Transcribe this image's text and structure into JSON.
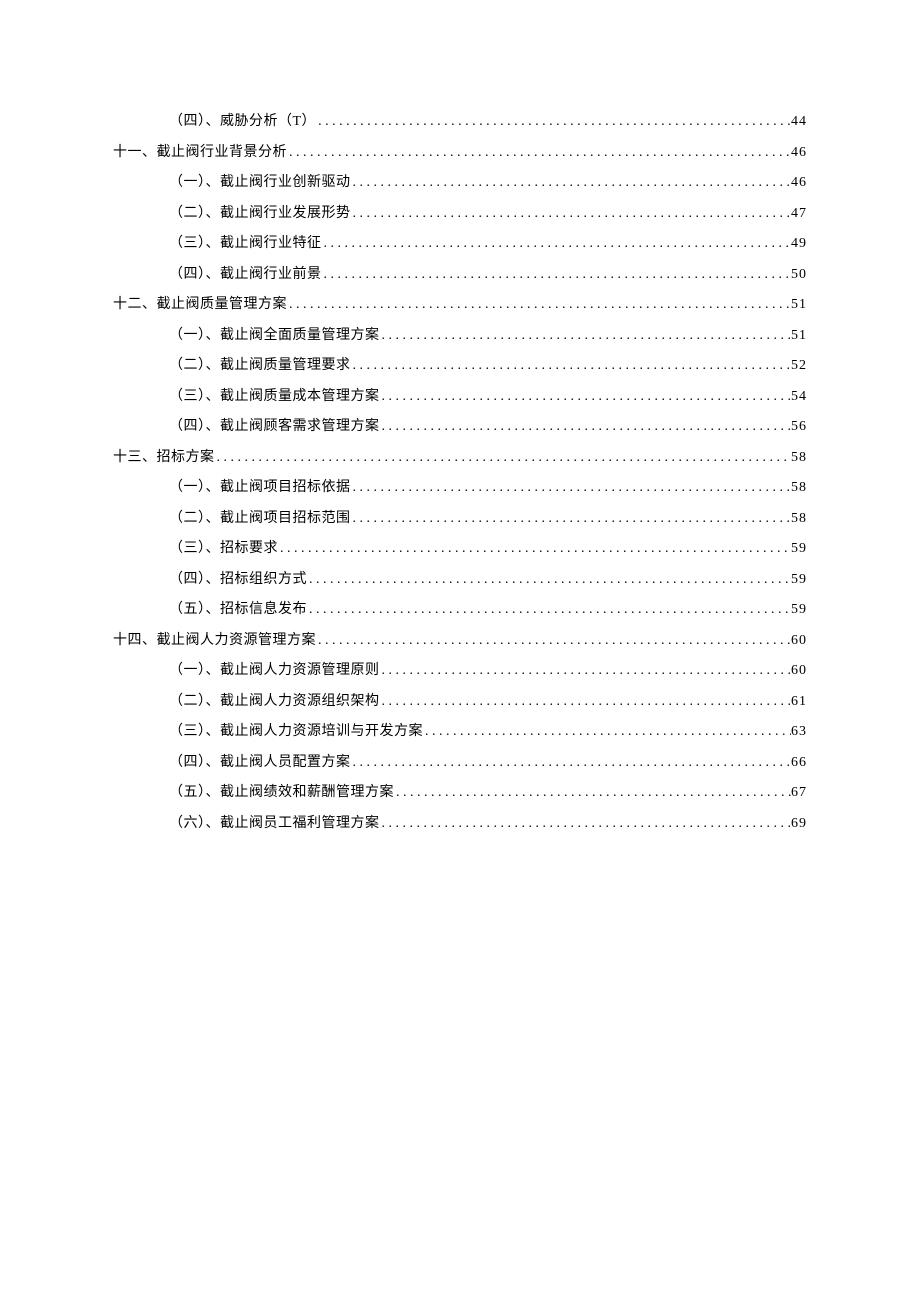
{
  "toc": {
    "entries": [
      {
        "level": 2,
        "title": "（四）、威胁分析（T）",
        "page": "44"
      },
      {
        "level": 1,
        "title": "十一、截止阀行业背景分析",
        "page": "46"
      },
      {
        "level": 2,
        "title": "（一）、截止阀行业创新驱动",
        "page": "46"
      },
      {
        "level": 2,
        "title": "（二）、截止阀行业发展形势",
        "page": "47"
      },
      {
        "level": 2,
        "title": "（三）、截止阀行业特征",
        "page": "49"
      },
      {
        "level": 2,
        "title": "（四）、截止阀行业前景",
        "page": "50"
      },
      {
        "level": 1,
        "title": "十二、截止阀质量管理方案",
        "page": "51"
      },
      {
        "level": 2,
        "title": "（一）、截止阀全面质量管理方案",
        "page": "51"
      },
      {
        "level": 2,
        "title": "（二）、截止阀质量管理要求",
        "page": "52"
      },
      {
        "level": 2,
        "title": "（三）、截止阀质量成本管理方案",
        "page": "54"
      },
      {
        "level": 2,
        "title": "（四）、截止阀顾客需求管理方案",
        "page": "56"
      },
      {
        "level": 1,
        "title": "十三、招标方案",
        "page": "58"
      },
      {
        "level": 2,
        "title": "（一）、截止阀项目招标依据",
        "page": "58"
      },
      {
        "level": 2,
        "title": "（二）、截止阀项目招标范围",
        "page": "58"
      },
      {
        "level": 2,
        "title": "（三）、招标要求",
        "page": "59"
      },
      {
        "level": 2,
        "title": "（四）、招标组织方式",
        "page": "59"
      },
      {
        "level": 2,
        "title": "（五）、招标信息发布",
        "page": "59"
      },
      {
        "level": 1,
        "title": "十四、截止阀人力资源管理方案",
        "page": "60"
      },
      {
        "level": 2,
        "title": "（一）、截止阀人力资源管理原则",
        "page": "60"
      },
      {
        "level": 2,
        "title": "（二）、截止阀人力资源组织架构",
        "page": "61"
      },
      {
        "level": 2,
        "title": "（三）、截止阀人力资源培训与开发方案",
        "page": "63"
      },
      {
        "level": 2,
        "title": "（四）、截止阀人员配置方案",
        "page": "66"
      },
      {
        "level": 2,
        "title": "（五）、截止阀绩效和薪酬管理方案",
        "page": "67"
      },
      {
        "level": 2,
        "title": "（六）、截止阀员工福利管理方案",
        "page": "69"
      }
    ]
  }
}
